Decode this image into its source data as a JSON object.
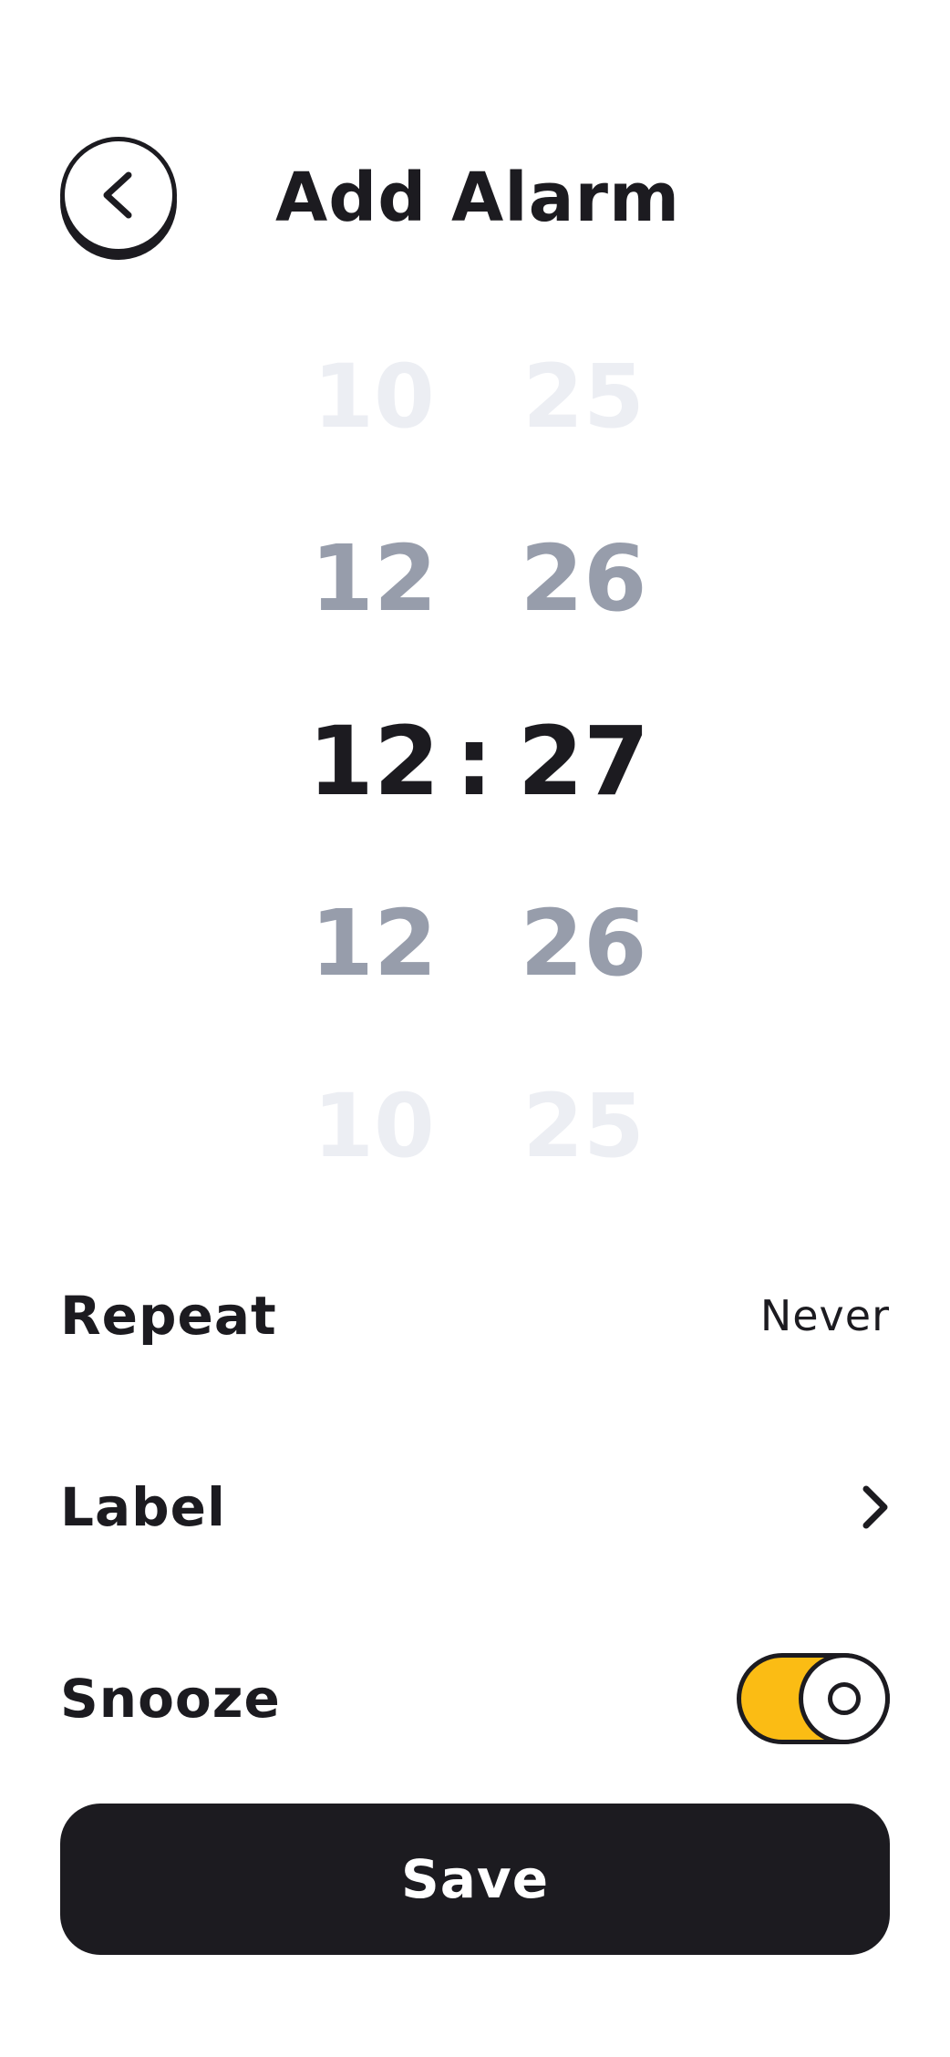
{
  "header": {
    "title": "Add Alarm",
    "back_icon": "chevron-left-icon"
  },
  "picker": {
    "hours": [
      "10",
      "12",
      "12",
      "12",
      "10"
    ],
    "minutes": [
      "25",
      "26",
      "27",
      "26",
      "25"
    ],
    "separator": ":",
    "selected": {
      "hour": "12",
      "minute": "27"
    }
  },
  "settings": {
    "repeat": {
      "label": "Repeat",
      "value": "Never"
    },
    "label": {
      "label": "Label",
      "icon": "chevron-right-icon"
    },
    "snooze": {
      "label": "Snooze",
      "enabled": true
    }
  },
  "actions": {
    "save_label": "Save"
  },
  "colors": {
    "primary": "#1c1b20",
    "accent": "#fbbc14",
    "muted": "#979dab",
    "faint": "#eceef3",
    "background": "#ffffff"
  }
}
